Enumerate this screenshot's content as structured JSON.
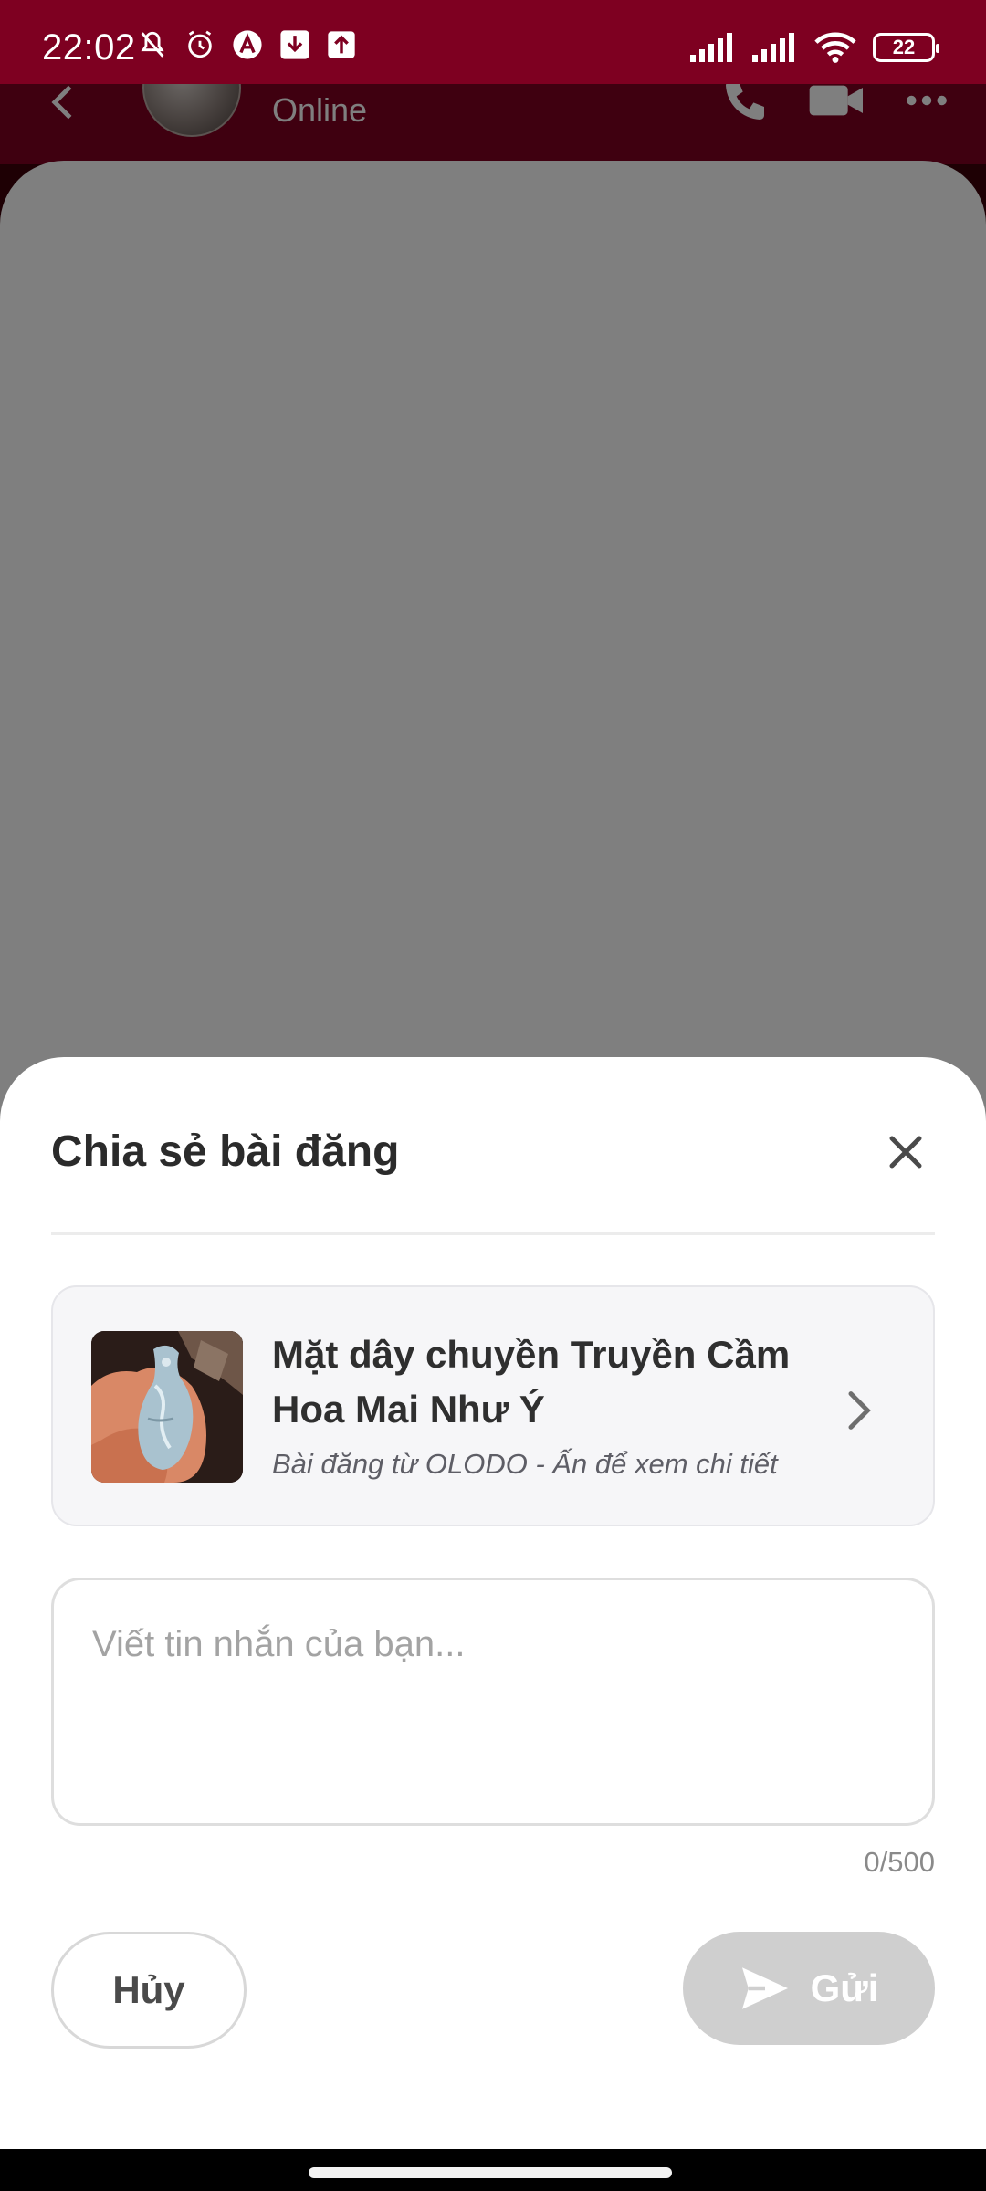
{
  "status_bar": {
    "time": "22:02",
    "battery": "22",
    "left_icons": [
      "bell-off-icon",
      "alarm-icon",
      "app-a-icon",
      "app-download-icon",
      "upload-icon"
    ],
    "right_icons": [
      "signal-1-icon",
      "signal-2-icon",
      "wifi-icon",
      "battery-icon"
    ]
  },
  "chat_header": {
    "status": "Online",
    "icons": [
      "back-arrow-icon",
      "phone-icon",
      "video-icon",
      "more-icon"
    ]
  },
  "share_sheet": {
    "title": "Chia sẻ bài đăng",
    "close_icon": "close-icon",
    "post": {
      "title": "Mặt dây chuyền Truyền Cầm Hoa Mai Như Ý",
      "subtitle": "Bài đăng từ OLODO - Ấn để xem chi tiết",
      "chevron_icon": "chevron-right-icon"
    },
    "message": {
      "value": "",
      "placeholder": "Viết tin nhắn của bạn...",
      "counter": "0/500"
    },
    "cancel_label": "Hủy",
    "send_label": "Gửi",
    "send_icon": "send-icon"
  },
  "colors": {
    "status_bar": "#7e0021",
    "scrim": "rgba(0,0,0,0.5)",
    "send_disabled": "#cfcfcf"
  }
}
